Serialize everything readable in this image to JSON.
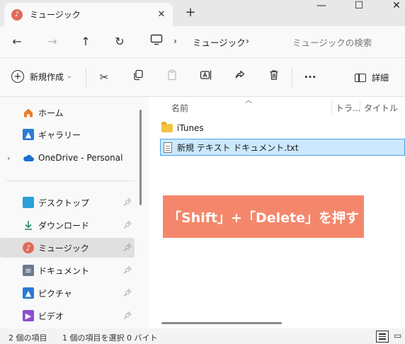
{
  "window": {
    "tab_title": "ミュージック",
    "new_tab": "+",
    "minimize": "—",
    "maximize": "☐",
    "close": "✕"
  },
  "address_bar": {
    "breadcrumb_sep": "›",
    "location": "ミュージック",
    "search_placeholder": "ミュージックの検索"
  },
  "command_bar": {
    "new_label": "新規作成",
    "details_label": "詳細",
    "more_label": "···"
  },
  "sidebar": {
    "items": [
      {
        "label": "ホーム",
        "icon": "home-icon"
      },
      {
        "label": "ギャラリー",
        "icon": "gallery-icon"
      },
      {
        "label": "OneDrive - Personal",
        "icon": "onedrive-icon"
      },
      {
        "label": "デスクトップ",
        "icon": "desktop-icon",
        "pinned": true
      },
      {
        "label": "ダウンロード",
        "icon": "download-icon",
        "pinned": true
      },
      {
        "label": "ミュージック",
        "icon": "music-icon",
        "pinned": true,
        "selected": true
      },
      {
        "label": "ドキュメント",
        "icon": "documents-icon",
        "pinned": true
      },
      {
        "label": "ピクチャ",
        "icon": "pictures-icon",
        "pinned": true
      },
      {
        "label": "ビデオ",
        "icon": "videos-icon",
        "pinned": true
      }
    ]
  },
  "columns": {
    "name": "名前",
    "track": "トラ...",
    "title": "タイトル"
  },
  "files": [
    {
      "name": "iTunes",
      "type": "folder",
      "selected": false
    },
    {
      "name": "新規 テキスト ドキュメント.txt",
      "type": "text-file",
      "selected": true
    }
  ],
  "overlay": {
    "text": "「Shift」+「Delete」を押す"
  },
  "status": {
    "item_count": "2 個の項目",
    "selection": "1 個の項目を選択  0 バイト"
  },
  "colors": {
    "accent": "#4aa0e8",
    "overlay": "#f4876b",
    "folder": "#f5c242"
  }
}
